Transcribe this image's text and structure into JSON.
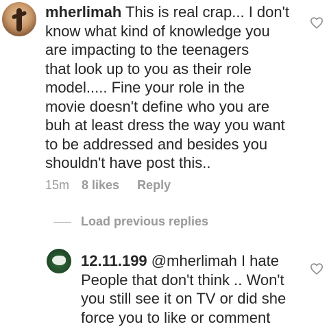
{
  "comment": {
    "username": "mherlimah",
    "text": "This is real crap... I don't\nknow what kind of knowledge you\nare impacting to the teenagers\nthat look up to you as their role\nmodel..... Fine your role in the\nmovie doesn't define who you are\nbuh at least dress the way you want\nto be addressed and besides you\nshouldn't have post this..",
    "time": "15m",
    "likes": "8 likes",
    "reply_label": "Reply"
  },
  "load_previous_replies": "Load previous replies",
  "reply": {
    "username": "12.11.199",
    "text": "@mherlimah I hate\nPeople that don't think .. Won't\nyou still see it on TV or did she\nforce you to like or comment"
  },
  "icons": {
    "like": "heart-outline-icon"
  },
  "colors": {
    "text": "#262626",
    "muted": "#9a9a9a"
  }
}
